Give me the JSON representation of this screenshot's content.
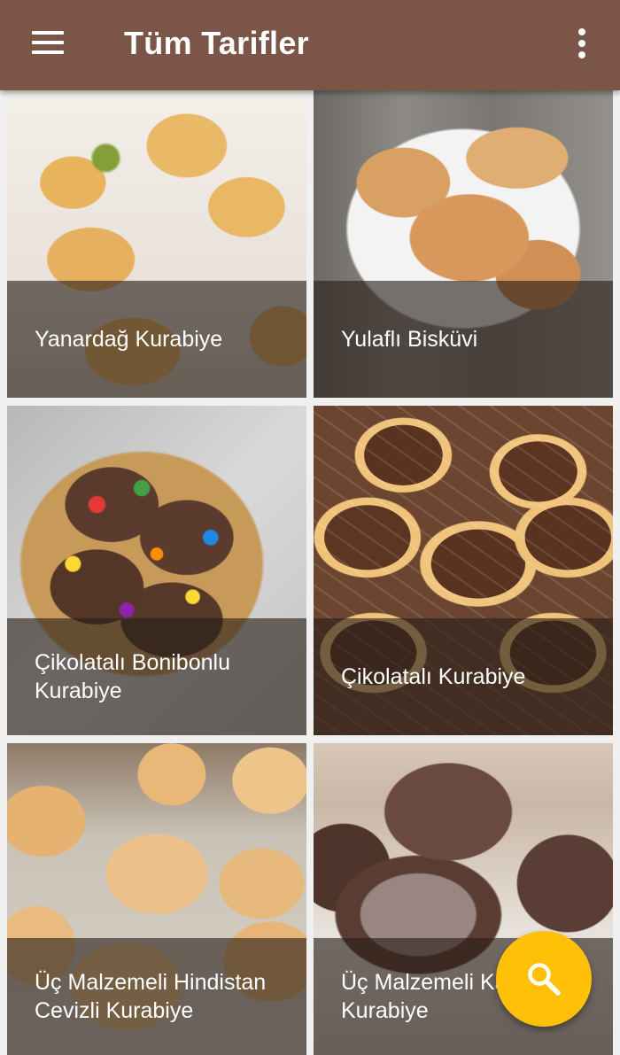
{
  "app_bar": {
    "title": "Tüm Tarifler",
    "background_color": "#7a5548",
    "menu_icon": "hamburger-menu-icon",
    "more_icon": "vertical-dots-icon"
  },
  "recipes": [
    {
      "title": "Yanardağ Kurabiye"
    },
    {
      "title": "Yulaflı Bisküvi"
    },
    {
      "title": "Çikolatalı Bonibonlu Kurabiye"
    },
    {
      "title": "Çikolatalı Kurabiye"
    },
    {
      "title": "Üç Malzemeli Hindistan Cevizli Kurabiye"
    },
    {
      "title": "Üç Malzemeli Kakaolu Kurabiye"
    }
  ],
  "fab": {
    "icon": "search-icon",
    "color": "#ffc107"
  }
}
